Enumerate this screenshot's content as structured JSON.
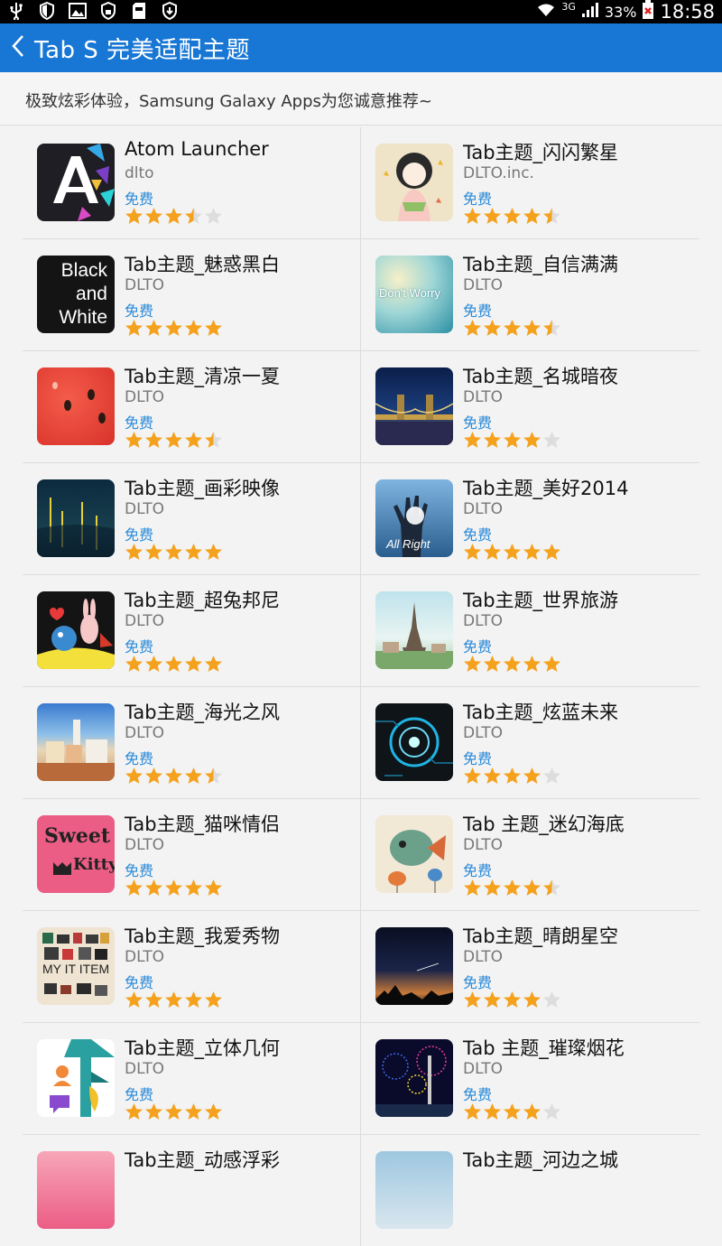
{
  "status_bar": {
    "battery_percent": "33%",
    "network": "3G",
    "time": "18:58"
  },
  "action_bar": {
    "title": "Tab S 完美适配主题",
    "back_icon": "chevron-left-icon"
  },
  "subtitle": "极致炫彩体验，Samsung Galaxy Apps为您诚意推荐~",
  "apps": [
    {
      "name": "Atom Launcher",
      "developer": "dlto",
      "price": "免费",
      "rating": 3.5,
      "thumb_theme": "atom"
    },
    {
      "name": "Tab主题_闪闪繁星",
      "developer": "DLTO.inc.",
      "price": "免费",
      "rating": 4.5,
      "thumb_theme": "girl"
    },
    {
      "name": "Tab主题_魅惑黑白",
      "developer": "DLTO",
      "price": "免费",
      "rating": 5,
      "thumb_theme": "blackwhite",
      "thumb_text": [
        "Black",
        "and",
        "White"
      ]
    },
    {
      "name": "Tab主题_自信满满",
      "developer": "DLTO",
      "price": "免费",
      "rating": 4.5,
      "thumb_theme": "dontworry",
      "thumb_text": [
        "Don't Worry"
      ]
    },
    {
      "name": "Tab主题_清凉一夏",
      "developer": "DLTO",
      "price": "免费",
      "rating": 4.5,
      "thumb_theme": "watermelon"
    },
    {
      "name": "Tab主题_名城暗夜",
      "developer": "DLTO",
      "price": "免费",
      "rating": 4,
      "thumb_theme": "bridge"
    },
    {
      "name": "Tab主题_画彩映像",
      "developer": "DLTO",
      "price": "免费",
      "rating": 5,
      "thumb_theme": "starrynight"
    },
    {
      "name": "Tab主题_美好2014",
      "developer": "DLTO",
      "price": "免费",
      "rating": 5,
      "thumb_theme": "allright",
      "thumb_text": [
        "All Right"
      ]
    },
    {
      "name": "Tab主题_超兔邦尼",
      "developer": "DLTO",
      "price": "免费",
      "rating": 5,
      "thumb_theme": "bunny"
    },
    {
      "name": "Tab主题_世界旅游",
      "developer": "DLTO",
      "price": "免费",
      "rating": 5,
      "thumb_theme": "eiffel"
    },
    {
      "name": "Tab主题_海光之风",
      "developer": "DLTO",
      "price": "免费",
      "rating": 4.5,
      "thumb_theme": "seaside"
    },
    {
      "name": "Tab主题_炫蓝未来",
      "developer": "DLTO",
      "price": "免费",
      "rating": 4,
      "thumb_theme": "tech"
    },
    {
      "name": "Tab主题_猫咪情侣",
      "developer": "DLTO",
      "price": "免费",
      "rating": 5,
      "thumb_theme": "sweetkitty",
      "thumb_text": [
        "Sweet",
        "Kitty"
      ]
    },
    {
      "name": "Tab 主题_迷幻海底",
      "developer": "DLTO",
      "price": "免费",
      "rating": 4.5,
      "thumb_theme": "fish"
    },
    {
      "name": "Tab主题_我爱秀物",
      "developer": "DLTO",
      "price": "免费",
      "rating": 5,
      "thumb_theme": "myitem",
      "thumb_text": [
        "MY IT ITEM"
      ]
    },
    {
      "name": "Tab主题_晴朗星空",
      "developer": "DLTO",
      "price": "免费",
      "rating": 4,
      "thumb_theme": "sky"
    },
    {
      "name": "Tab主题_立体几何",
      "developer": "DLTO",
      "price": "免费",
      "rating": 5,
      "thumb_theme": "geometry"
    },
    {
      "name": "Tab 主题_璀璨烟花",
      "developer": "DLTO",
      "price": "免费",
      "rating": 4,
      "thumb_theme": "fireworks"
    },
    {
      "name": "Tab主题_动感浮彩",
      "developer": "",
      "price": "",
      "rating": null,
      "thumb_theme": "pink"
    },
    {
      "name": "Tab主题_河边之城",
      "developer": "",
      "price": "",
      "rating": null,
      "thumb_theme": "river"
    }
  ],
  "colors": {
    "action_bar": "#1877d5",
    "price": "#2a8ad8",
    "star_full": "#f4a21e",
    "star_empty": "#dddddd"
  }
}
